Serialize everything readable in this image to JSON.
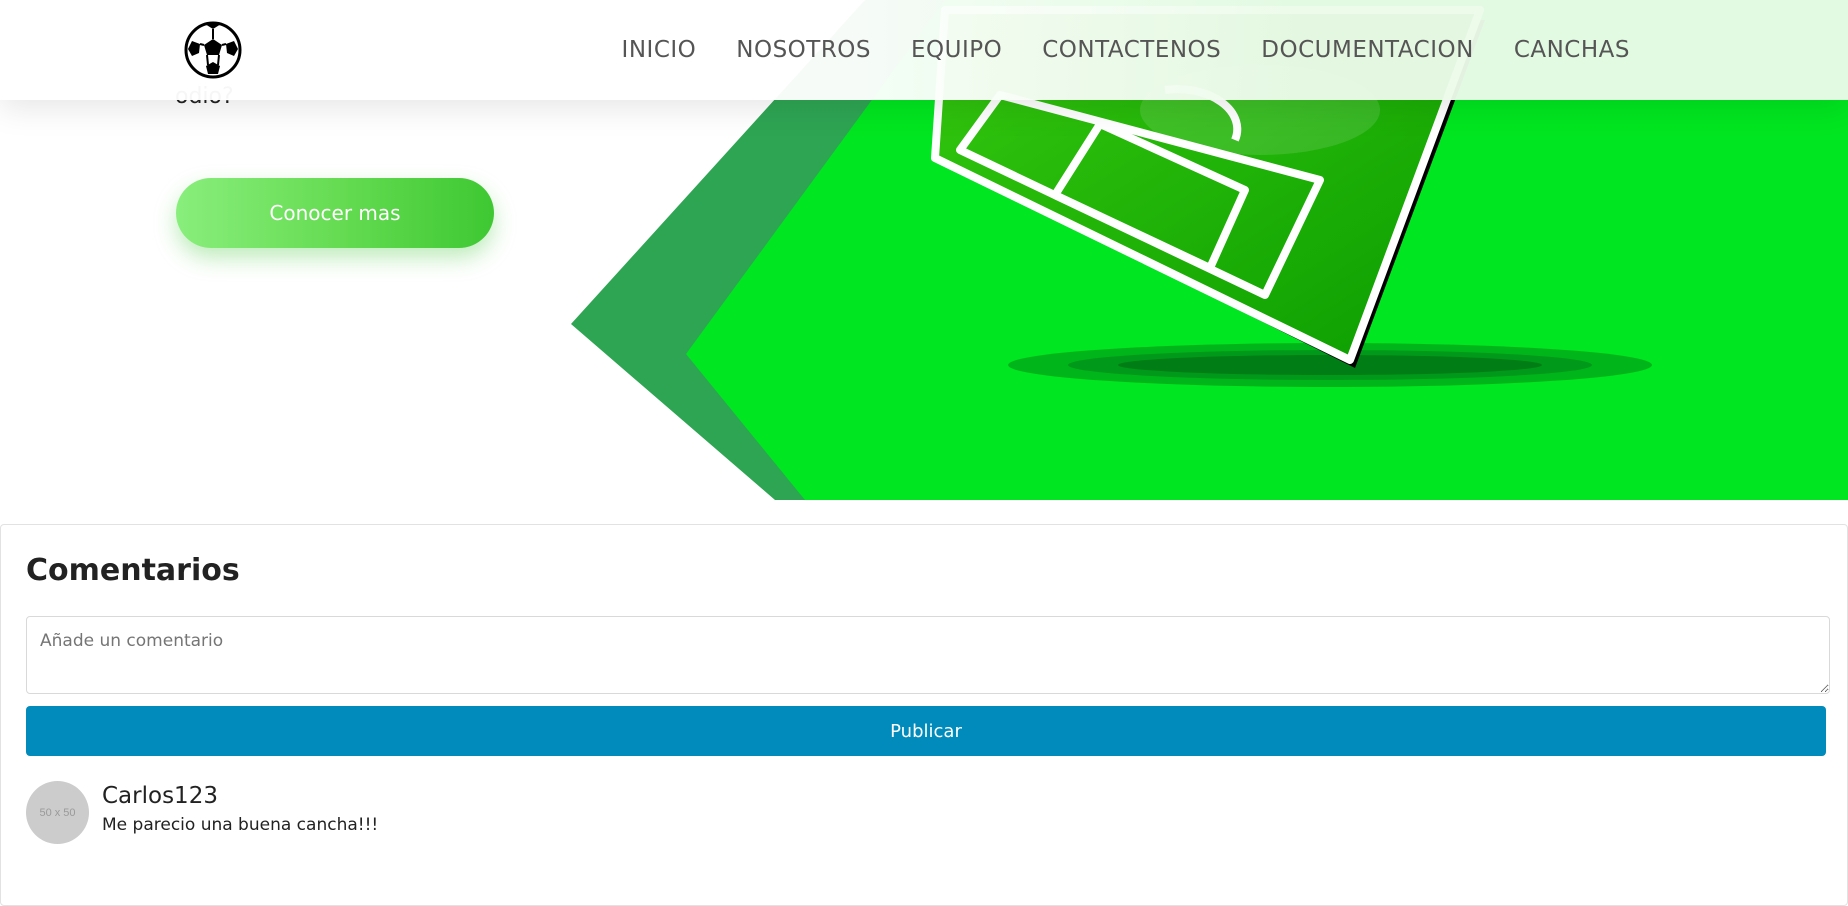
{
  "navbar": {
    "links": [
      {
        "label": "INICIO"
      },
      {
        "label": "NOSOTROS"
      },
      {
        "label": "EQUIPO"
      },
      {
        "label": "CONTACTENOS"
      },
      {
        "label": "DOCUMENTACION"
      },
      {
        "label": "CANCHAS"
      }
    ]
  },
  "hero": {
    "cut_text": "odio?",
    "cta_label": "Conocer mas"
  },
  "comments": {
    "title": "Comentarios",
    "input_placeholder": "Añade un comentario",
    "publish_label": "Publicar",
    "items": [
      {
        "avatar_label": "50 x 50",
        "user": "Carlos123",
        "text": "Me parecio una buena cancha!!!"
      }
    ]
  },
  "colors": {
    "hero_green": "#00e620",
    "stripe_green": "#2ea553",
    "field_green": "#1db800",
    "publish_blue": "#008bbc"
  }
}
